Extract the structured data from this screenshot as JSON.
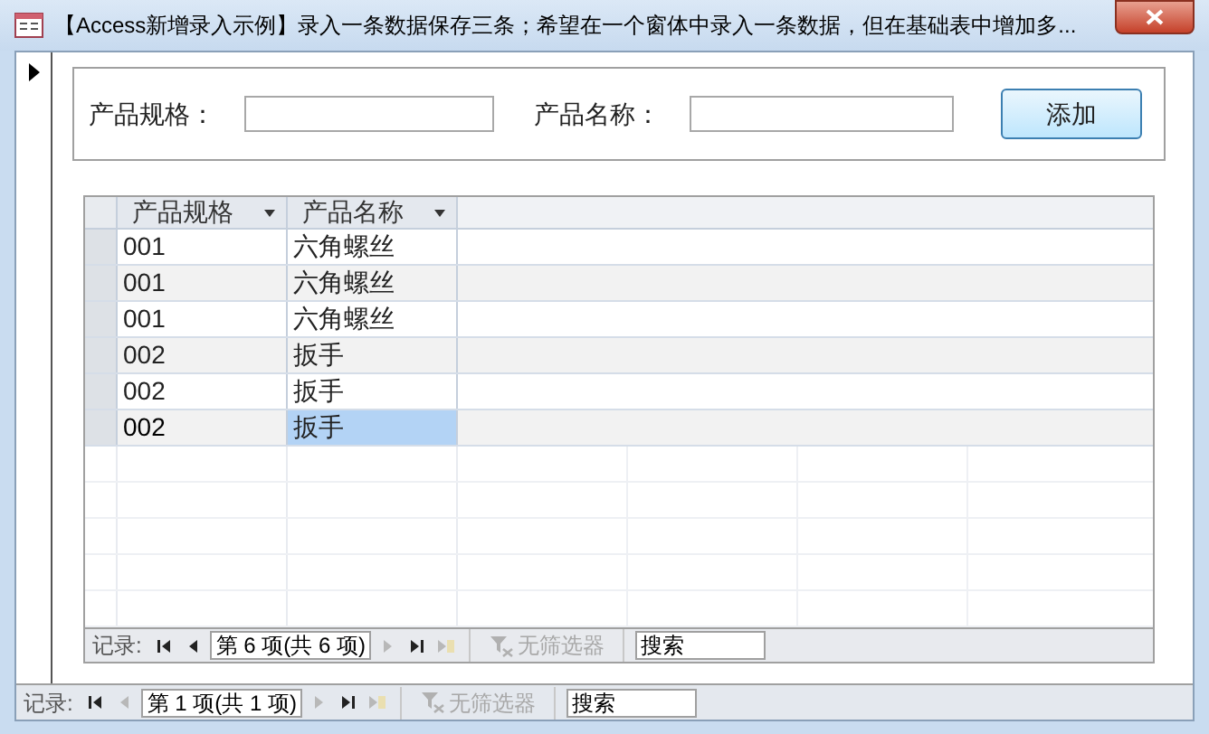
{
  "window": {
    "title": "【Access新增录入示例】录入一条数据保存三条；希望在一个窗体中录入一条数据，但在基础表中增加多..."
  },
  "form": {
    "fields": [
      {
        "label": "产品规格："
      },
      {
        "label": "产品名称："
      }
    ],
    "button": "添加"
  },
  "table": {
    "columns": [
      {
        "label": "产品规格"
      },
      {
        "label": "产品名称"
      }
    ],
    "rows": [
      {
        "cells": [
          "001",
          "六角螺丝"
        ],
        "selected": false
      },
      {
        "cells": [
          "001",
          "六角螺丝"
        ],
        "selected": false
      },
      {
        "cells": [
          "001",
          "六角螺丝"
        ],
        "selected": false
      },
      {
        "cells": [
          "002",
          "扳手"
        ],
        "selected": false
      },
      {
        "cells": [
          "002",
          "扳手"
        ],
        "selected": false
      },
      {
        "cells": [
          "002",
          "扳手"
        ],
        "selected": true
      }
    ]
  },
  "inner_nav": {
    "label": "记录:",
    "buttons": [
      {
        "kind": "first",
        "disabled": false
      },
      {
        "kind": "prev",
        "disabled": false
      }
    ],
    "position": "第 6 项(共 6 项)",
    "after": [
      {
        "kind": "next",
        "disabled": true
      },
      {
        "kind": "last",
        "disabled": false
      },
      {
        "kind": "new",
        "disabled": true
      }
    ],
    "filter": "无筛选器",
    "search": "搜索"
  },
  "outer_nav": {
    "label": "记录:",
    "buttons": [
      {
        "kind": "first",
        "disabled": false
      },
      {
        "kind": "prev",
        "disabled": true
      }
    ],
    "position": "第 1 项(共 1 项)",
    "after": [
      {
        "kind": "next",
        "disabled": true
      },
      {
        "kind": "last",
        "disabled": false
      },
      {
        "kind": "new",
        "disabled": true
      }
    ],
    "filter": "无筛选器",
    "search": "搜索"
  }
}
